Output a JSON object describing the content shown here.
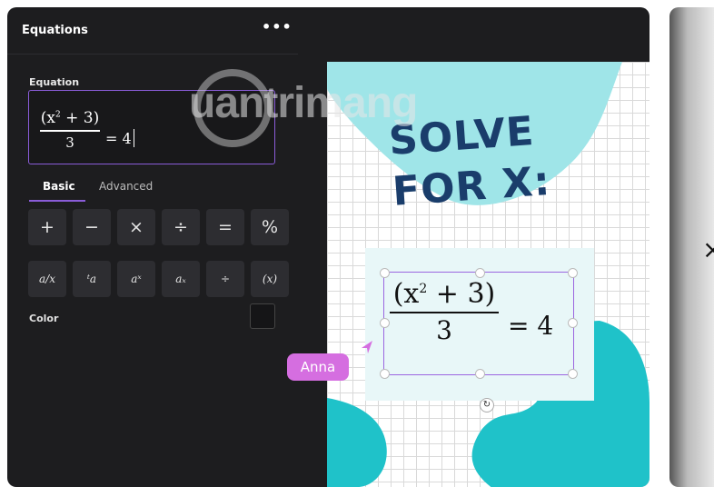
{
  "panel": {
    "title": "Equations",
    "more_label": "•••",
    "equation_label": "Equation",
    "equation_input": {
      "numerator": "(x",
      "exponent": "2",
      "numerator_rest": " + 3)",
      "denominator": "3",
      "rhs": "= 4"
    },
    "tabs": [
      {
        "label": "Basic",
        "active": true
      },
      {
        "label": "Advanced",
        "active": false
      }
    ],
    "keys_row1": [
      "+",
      "−",
      "×",
      "÷",
      "=",
      "%"
    ],
    "keys_row2": [
      "a/x",
      "ᵗa",
      "aˣ",
      "aₓ",
      "÷",
      "(x)"
    ],
    "color_label": "Color",
    "color_value": "#151517"
  },
  "canvas": {
    "headline_line1": "SOLVE",
    "headline_line2": "FOR X:",
    "equation": {
      "numerator": "(x",
      "exponent": "2",
      "numerator_rest": " + 3)",
      "denominator": "3",
      "rhs": "=  4"
    },
    "collaborator_name": "Anna",
    "accent_colors": {
      "teal_light": "#9fe5e8",
      "teal": "#1fc2c9",
      "navy": "#1a3d6b",
      "selection": "#9b66e0",
      "tag": "#d56ee0"
    }
  },
  "watermark": {
    "text": "uantrimang"
  },
  "right_panel": {
    "glyph": "×"
  }
}
